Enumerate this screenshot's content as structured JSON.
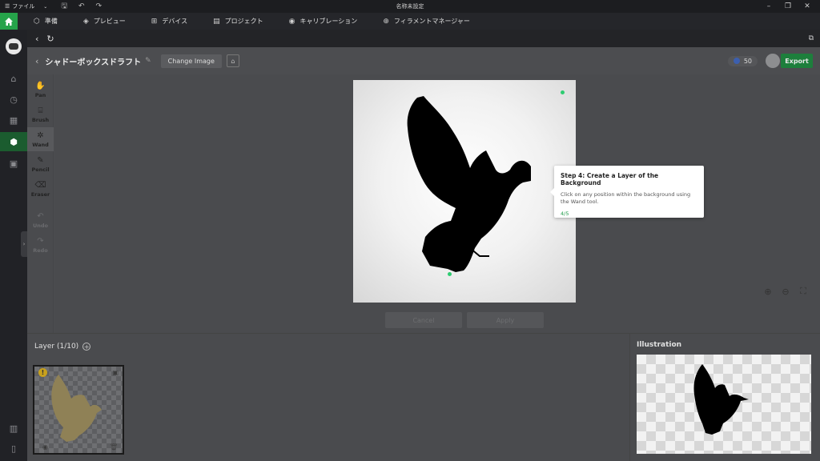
{
  "titlebar": {
    "menu_label": "ファイル",
    "window_title": "名称未設定"
  },
  "topnav": {
    "tabs": [
      {
        "label": "準備",
        "icon": "cube-icon"
      },
      {
        "label": "プレビュー",
        "icon": "layers-icon"
      },
      {
        "label": "デバイス",
        "icon": "device-icon"
      },
      {
        "label": "プロジェクト",
        "icon": "project-icon"
      },
      {
        "label": "キャリブレーション",
        "icon": "calibration-icon"
      },
      {
        "label": "フィラメントマネージャー",
        "icon": "filament-icon"
      }
    ]
  },
  "header": {
    "title": "シャドーボックスドラフト",
    "change_image": "Change Image",
    "credits": "50",
    "export": "Export"
  },
  "tools": [
    {
      "label": "Pan",
      "icon": "hand-icon"
    },
    {
      "label": "Brush",
      "icon": "brush-icon"
    },
    {
      "label": "Wand",
      "icon": "wand-icon"
    },
    {
      "label": "Pencil",
      "icon": "pencil-icon"
    },
    {
      "label": "Eraser",
      "icon": "eraser-icon"
    },
    {
      "label": "Undo",
      "icon": "undo-icon"
    },
    {
      "label": "Redo",
      "icon": "redo-icon"
    }
  ],
  "actions": {
    "cancel": "Cancel",
    "apply": "Apply"
  },
  "layers": {
    "title": "Layer (1/10)"
  },
  "illustration": {
    "title": "Illustration"
  },
  "tooltip": {
    "title": "Step 4: Create a Layer of the Background",
    "body": "Click on any position within the background using the Wand tool.",
    "step": "4/5"
  },
  "colors": {
    "accent": "#26a34a",
    "export_bg": "#1d7f3c",
    "step_text": "#1e9a48"
  }
}
